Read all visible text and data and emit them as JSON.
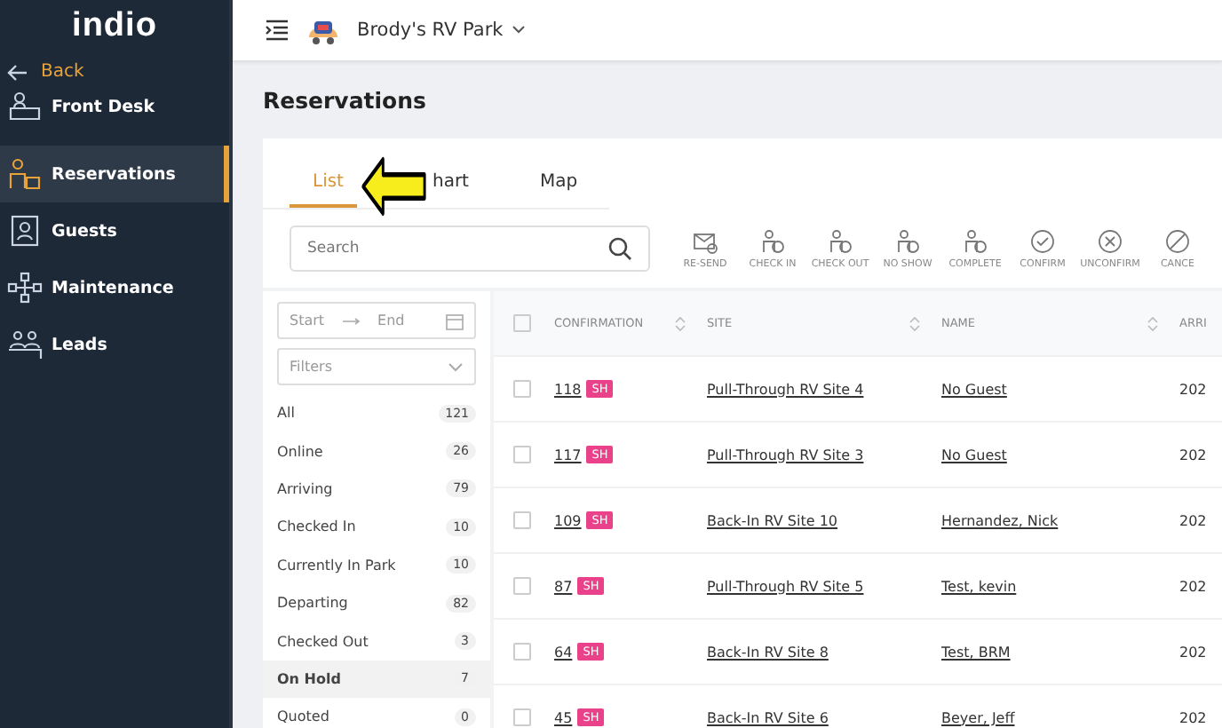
{
  "sidebar": {
    "logo": "indio",
    "back": "Back",
    "items": [
      {
        "label": "Front Desk",
        "selected": false
      },
      {
        "label": "Reservations",
        "selected": true
      },
      {
        "label": "Guests",
        "selected": false
      },
      {
        "label": "Maintenance",
        "selected": false
      },
      {
        "label": "Leads",
        "selected": false
      }
    ]
  },
  "topbar": {
    "park": "Brody's RV Park"
  },
  "page_title": "Reservations",
  "tabs": [
    {
      "label": "List",
      "selected": true
    },
    {
      "label": "hart",
      "selected": false
    },
    {
      "label": "Map",
      "selected": false
    }
  ],
  "search": {
    "placeholder": "Search"
  },
  "actions": [
    "RE-SEND",
    "CHECK IN",
    "CHECK OUT",
    "NO SHOW",
    "COMPLETE",
    "CONFIRM",
    "UNCONFIRM",
    "CANCE"
  ],
  "date_range": {
    "start": "Start",
    "end": "End"
  },
  "filters_dropdown": {
    "placeholder": "Filters"
  },
  "filters": [
    {
      "label": "All",
      "count": "121",
      "selected": false
    },
    {
      "label": "Online",
      "count": "26",
      "selected": false
    },
    {
      "label": "Arriving",
      "count": "79",
      "selected": false
    },
    {
      "label": "Checked In",
      "count": "10",
      "selected": false
    },
    {
      "label": "Currently In Park",
      "count": "10",
      "selected": false
    },
    {
      "label": "Departing",
      "count": "82",
      "selected": false
    },
    {
      "label": "Checked Out",
      "count": "3",
      "selected": false
    },
    {
      "label": "On Hold",
      "count": "7",
      "selected": true
    },
    {
      "label": "Quoted",
      "count": "0",
      "selected": false
    }
  ],
  "table": {
    "select_all_checked": false,
    "columns": [
      "CONFIRMATION",
      "SITE",
      "NAME",
      "ARRI"
    ],
    "rows": [
      {
        "confirmation": "118",
        "tag": "SH",
        "site": "Pull-Through RV Site 4",
        "name": "No Guest",
        "arrival": "202",
        "checked": false
      },
      {
        "confirmation": "117",
        "tag": "SH",
        "site": "Pull-Through RV Site 3",
        "name": "No Guest",
        "arrival": "202",
        "checked": false
      },
      {
        "confirmation": "109",
        "tag": "SH",
        "site": "Back-In RV Site 10",
        "name": "Hernandez, Nick",
        "arrival": "202",
        "checked": false
      },
      {
        "confirmation": "87",
        "tag": "SH",
        "site": "Pull-Through RV Site 5",
        "name": "Test, kevin",
        "arrival": "202",
        "checked": false
      },
      {
        "confirmation": "64",
        "tag": "SH",
        "site": "Back-In RV Site 8",
        "name": "Test, BRM",
        "arrival": "202",
        "checked": false
      },
      {
        "confirmation": "45",
        "tag": "SH",
        "site": "Back-In RV Site 6",
        "name": "Beyer, Jeff",
        "arrival": "202",
        "checked": false
      }
    ]
  }
}
